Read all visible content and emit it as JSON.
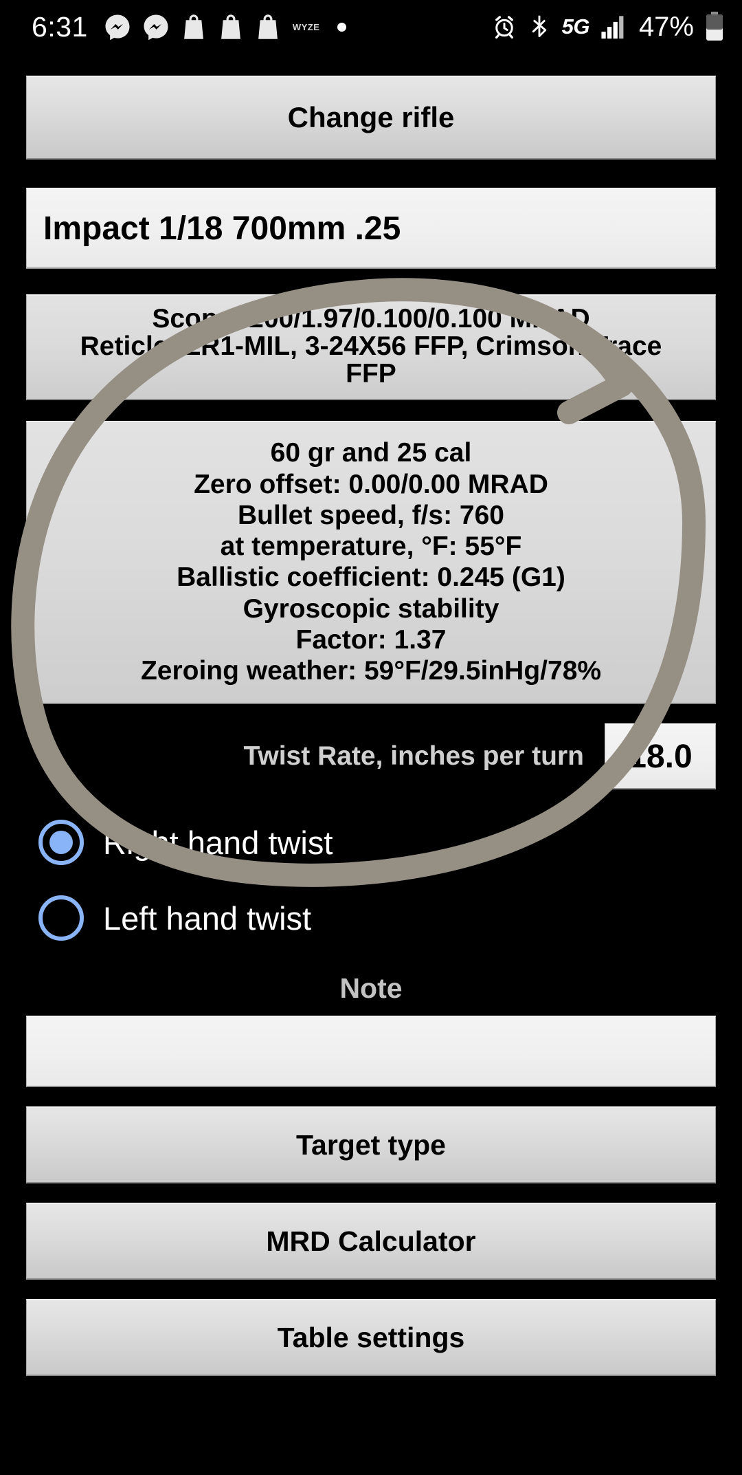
{
  "status_bar": {
    "time": "6:31",
    "left_icons": [
      "messenger-icon",
      "messenger-icon",
      "bag-icon",
      "bag-icon",
      "bag-icon"
    ],
    "wyze_label": "WYZE",
    "dot_icon": "dot-icon",
    "right_icons": [
      "alarm-icon",
      "bluetooth-icon"
    ],
    "network_label": "5G",
    "signal_icon": "signal-bars-icon",
    "battery_percent": "47%",
    "battery_icon": "battery-icon"
  },
  "app": {
    "change_rifle_button": "Change rifle",
    "rifle_name": "Impact 1/18 700mm .25",
    "scope_info": {
      "line1": "Scope: 200/1.97/0.100/0.100 MRAD",
      "line2": "Reticle: LR1-MIL, 3-24X56 FFP, Crimson Trace",
      "line3": "FFP"
    },
    "ammo_info": {
      "line1": "60 gr  and 25 cal",
      "line2": "Zero offset: 0.00/0.00 MRAD",
      "line3": "Bullet speed, f/s: 760",
      "line4": "at temperature, °F: 55°F",
      "line5": "Ballistic coefficient: 0.245 (G1)",
      "line6": "Gyroscopic stability",
      "line7": "Factor: 1.37",
      "line8": "Zeroing weather: 59°F/29.5inHg/78%"
    },
    "twist_rate": {
      "label": "Twist Rate, inches per turn",
      "value": "18.0"
    },
    "twist_direction": {
      "right_label": "Right hand twist",
      "left_label": "Left hand twist",
      "selected": "right"
    },
    "note": {
      "label": "Note",
      "value": "",
      "placeholder": ""
    },
    "buttons": {
      "target_type": "Target type",
      "mrd_calculator": "MRD Calculator",
      "table_settings": "Table settings"
    }
  },
  "annotation": {
    "type": "hand-drawn-circle",
    "color": "#968f84",
    "description": "circle drawn around ammo/ballistics info block"
  },
  "colors": {
    "background": "#000000",
    "button_face": "#dcdcdc",
    "field_face": "#f0f0f0",
    "radio_accent": "#8ab4f8",
    "label_gray": "#c6c6c6",
    "annotation": "#968f84"
  }
}
